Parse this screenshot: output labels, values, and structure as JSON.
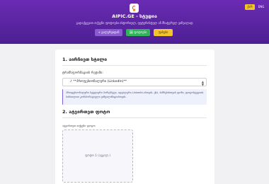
{
  "header": {
    "logo_icon": "aipic-logo-icon",
    "title": "AIPIC.GE - სტუდია",
    "subtitle": "გადაქცევით თქვენი ფოტოები ისტორიულ, ფუტურისტულ ან მხატვრულ ვიზუალად",
    "buttons": {
      "gallery": "+ გალერეიდან",
      "photo": "🖼 ფოტოები",
      "pricing": "ფასები"
    },
    "lang": {
      "ka": "ქარ",
      "en": "ENG"
    }
  },
  "section1": {
    "title": "1. აირჩიეთ სტილი",
    "field_label": "ტრანსფორმაციის რეჟიმი:",
    "select_value": "♪ **პროფესიონალური (LinkedIn)**",
    "select_arrow_icon": "chevron-down-icon",
    "info_text": "პროფესიონალური სტუდიური პორტრეტი, იდეალური LinkedIn-ისთვის. უნა, ბიზნესისთვის ფონი, ფოტოსტუდიის სინათლით კორპორატიული ვიზუალიზაციისთვის."
  },
  "section2": {
    "title": "2. ატვირთეთ ფოტო",
    "upload_label": "ატვირთეთ თქვენი ფოტო:",
    "upload_text": "ფოტო 1 (აუცილ.)"
  },
  "colors": {
    "header_top": "#6a2bb3",
    "header_bottom": "#4d1f93",
    "accent_yellow": "#f4c42b",
    "accent_green": "#2fb45a",
    "accent_purple": "#8a5ad1"
  }
}
